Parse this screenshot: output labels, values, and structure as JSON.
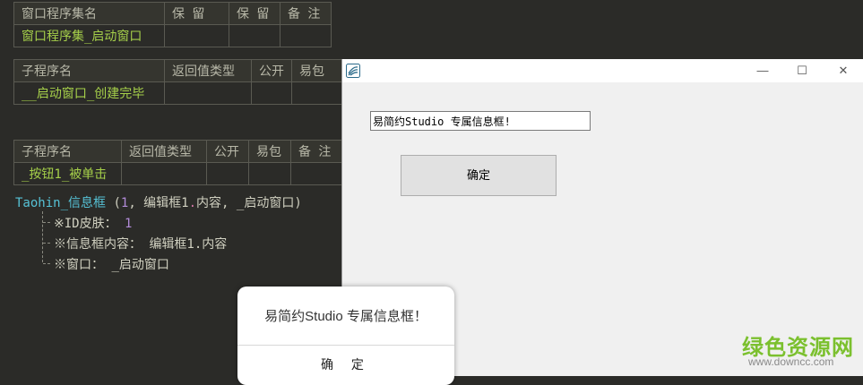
{
  "table1": {
    "headers": [
      "窗口程序集名",
      "保 留",
      "保 留",
      "备 注"
    ],
    "row": [
      "窗口程序集_启动窗口",
      "",
      "",
      ""
    ]
  },
  "table2": {
    "headers": [
      "子程序名",
      "返回值类型",
      "公开",
      "易包"
    ],
    "row": [
      "__启动窗口_创建完毕",
      "",
      "",
      ""
    ]
  },
  "table3": {
    "headers": [
      "子程序名",
      "返回值类型",
      "公开",
      "易包",
      "备 注"
    ],
    "row": [
      "_按钮1_被单击",
      "",
      "",
      "",
      ""
    ]
  },
  "code": {
    "func": "Taohin_信息框",
    "open": " (",
    "arg1": "1",
    "sep1": ", 编辑框1",
    "dot": ".",
    "arg2": "内容",
    "sep2": ", _启动窗口)",
    "params": [
      {
        "label": "※ID皮肤：",
        "value": "1"
      },
      {
        "label": "※信息框内容：",
        "value": "编辑框1.内容"
      },
      {
        "label": "※窗口：",
        "value": "_启动窗口"
      }
    ]
  },
  "window": {
    "controls": {
      "minimize": "—",
      "maximize": "☐",
      "close": "✕"
    },
    "edit_value": "易简约Studio  专属信息框!",
    "button_label": "确定"
  },
  "popup": {
    "message": "易简约Studio  专属信息框！",
    "button_label": "确  定"
  },
  "watermark": {
    "title": "绿色资源网",
    "url": "www.downcc.com"
  },
  "colors": {
    "background": "#2b2b28",
    "subname": "#a6d04a",
    "function": "#56c2d6",
    "watermark": "#7bc02e"
  }
}
